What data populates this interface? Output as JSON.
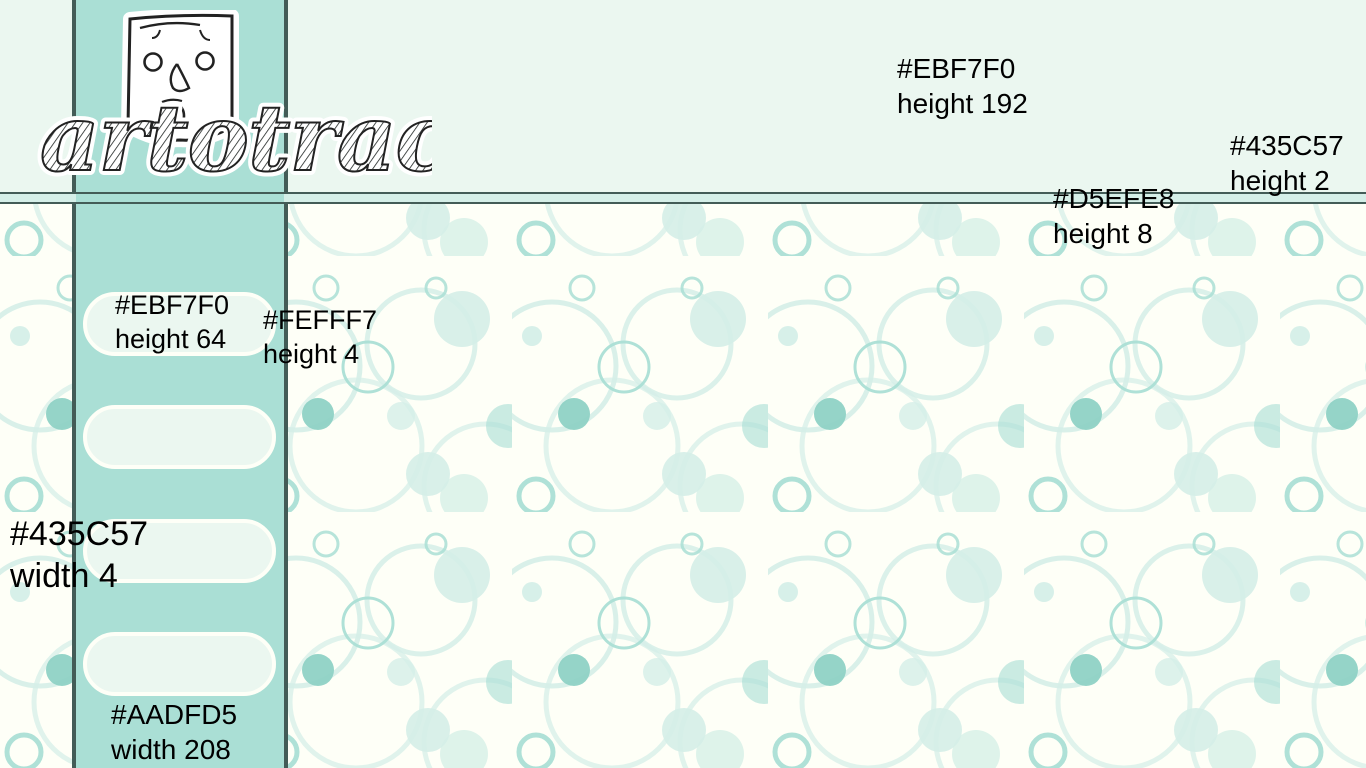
{
  "logo": {
    "text": "artotract"
  },
  "colors": {
    "header_background": "#EBF7F0",
    "border_color": "#435C57",
    "stripe_color": "#D5EFE8",
    "page_background": "#FEFFF7",
    "sidebar_background": "#AADFD5",
    "pill_background": "#EBF7F0",
    "pattern_light": "#D5EFE8",
    "pattern_mid": "#AADFD5",
    "pattern_dark": "#8FD1C5"
  },
  "annotations": {
    "header": {
      "color": "#EBF7F0",
      "size": "height 192"
    },
    "rule": {
      "color": "#435C57",
      "size": "height 2"
    },
    "stripe": {
      "color": "#D5EFE8",
      "size": "height 8"
    },
    "pill": {
      "color": "#EBF7F0",
      "size": "height 64"
    },
    "white": {
      "color": "#FEFFF7",
      "size": "height 4"
    },
    "border": {
      "color": "#435C57",
      "size": "width 4"
    },
    "sidebar": {
      "color": "#AADFD5",
      "size": "width 208"
    }
  },
  "icons": {
    "logo_mascot": "face-mascot-icon",
    "pattern_shapes": "bubble-circle-icon"
  }
}
